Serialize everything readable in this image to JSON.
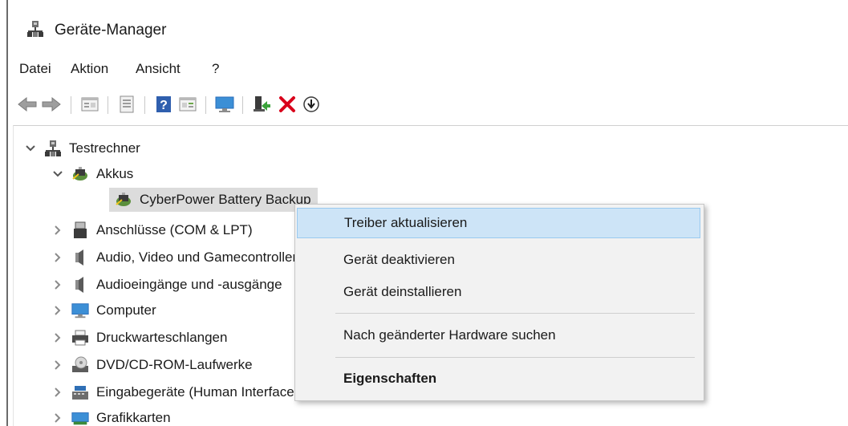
{
  "window": {
    "title": "Geräte-Manager"
  },
  "menu": [
    "Datei",
    "Aktion",
    "Ansicht",
    "?"
  ],
  "toolbar": {
    "buttons": [
      "back-icon",
      "forward-icon",
      "properties-icon",
      "refresh-icon",
      "help-icon",
      "details-pane-icon",
      "monitor-icon",
      "update-driver-icon",
      "uninstall-icon",
      "download-icon"
    ]
  },
  "tree": {
    "root": "Testrechner",
    "akkus": "Akkus",
    "battery": "CyberPower Battery Backup",
    "items": [
      "Anschlüsse (COM & LPT)",
      "Audio, Video und Gamecontroller",
      "Audioeingänge und -ausgänge",
      "Computer",
      "Druckwarteschlangen",
      "DVD/CD-ROM-Laufwerke",
      "Eingabegeräte (Human Interface Devices)",
      "Grafikkarten"
    ]
  },
  "context_menu": {
    "items": [
      "Treiber aktualisieren",
      "Gerät deaktivieren",
      "Gerät deinstallieren",
      "Nach geänderter Hardware suchen",
      "Eigenschaften"
    ]
  },
  "colors": {
    "highlight": "#cde4f7",
    "delete": "#d9001b",
    "accent": "#2a6ebb"
  }
}
